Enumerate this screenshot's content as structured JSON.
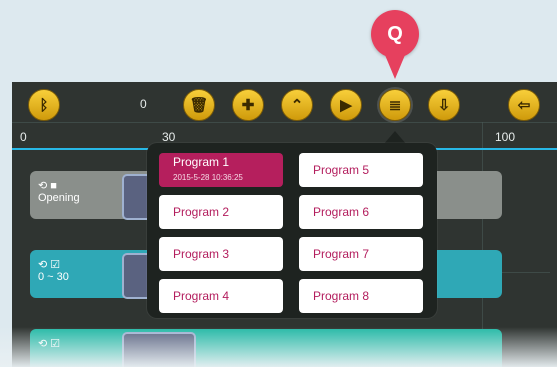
{
  "callout": {
    "label": "Q"
  },
  "toolbar": {
    "counter": "0",
    "buttons": [
      {
        "name": "bluetooth",
        "icon": "bluetooth-icon"
      },
      {
        "name": "trash",
        "icon": "trash-icon"
      },
      {
        "name": "add",
        "icon": "add-icon"
      },
      {
        "name": "up",
        "icon": "up-icon"
      },
      {
        "name": "play",
        "icon": "play-icon"
      },
      {
        "name": "programs",
        "icon": "programs-icon"
      },
      {
        "name": "save",
        "icon": "save-icon"
      },
      {
        "name": "exit",
        "icon": "exit-icon"
      }
    ]
  },
  "timeline": {
    "labels": {
      "start": "0",
      "mid": "30",
      "end": "100"
    }
  },
  "tracks": [
    {
      "label": "Opening",
      "count": "1"
    },
    {
      "label": "0 ~ 30",
      "count": "1"
    },
    {
      "label": "",
      "count": ""
    }
  ],
  "popup": {
    "programs": [
      {
        "label": "Program 1",
        "sub": "2015-5-28 10:36:25"
      },
      {
        "label": "Program 2"
      },
      {
        "label": "Program 3"
      },
      {
        "label": "Program 4"
      },
      {
        "label": "Program 5"
      },
      {
        "label": "Program 6"
      },
      {
        "label": "Program 7"
      },
      {
        "label": "Program 8"
      }
    ]
  }
}
